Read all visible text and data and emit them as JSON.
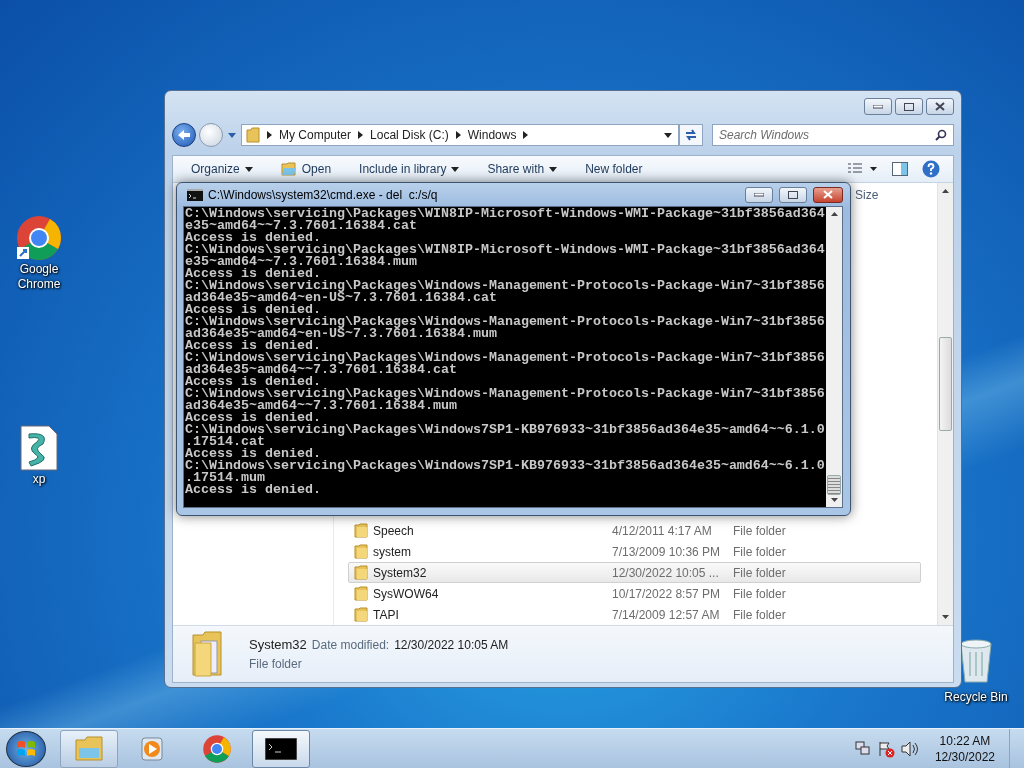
{
  "desktop_icons": [
    {
      "kind": "chrome",
      "label": "Google Chrome"
    },
    {
      "kind": "script",
      "label": "xp"
    },
    {
      "kind": "recycle",
      "label": "Recycle Bin"
    }
  ],
  "explorer": {
    "breadcrumb": [
      "My Computer",
      "Local Disk (C:)",
      "Windows"
    ],
    "search": {
      "placeholder": "Search Windows"
    },
    "toolbar": [
      {
        "kind": "menu",
        "label": "Organize"
      },
      {
        "kind": "open",
        "label": "Open"
      },
      {
        "kind": "menu",
        "label": "Include in library"
      },
      {
        "kind": "menu",
        "label": "Share with"
      },
      {
        "kind": "plain",
        "label": "New folder"
      }
    ],
    "columns": [
      "Size"
    ],
    "rows": [
      {
        "name": "Speech",
        "date": "4/12/2011 4:17 AM",
        "type": "File folder",
        "selected": false
      },
      {
        "name": "system",
        "date": "7/13/2009 10:36 PM",
        "type": "File folder",
        "selected": false
      },
      {
        "name": "System32",
        "date": "12/30/2022 10:05 ...",
        "type": "File folder",
        "selected": true
      },
      {
        "name": "SysWOW64",
        "date": "10/17/2022 8:57 PM",
        "type": "File folder",
        "selected": false
      },
      {
        "name": "TAPI",
        "date": "7/14/2009 12:57 AM",
        "type": "File folder",
        "selected": false
      }
    ],
    "details": {
      "name": "System32",
      "date_label": "Date modified:",
      "date": "12/30/2022 10:05 AM",
      "type": "File folder"
    }
  },
  "cmd": {
    "title": "C:\\Windows\\system32\\cmd.exe - del  c:/s/q",
    "lines": [
      "C:\\Windows\\servicing\\Packages\\WIN8IP-Microsoft-Windows-WMI-Package~31bf3856ad364",
      "e35~amd64~~7.3.7601.16384.cat",
      "Access is denied.",
      "C:\\Windows\\servicing\\Packages\\WIN8IP-Microsoft-Windows-WMI-Package~31bf3856ad364",
      "e35~amd64~~7.3.7601.16384.mum",
      "Access is denied.",
      "C:\\Windows\\servicing\\Packages\\Windows-Management-Protocols-Package-Win7~31bf3856",
      "ad364e35~amd64~en-US~7.3.7601.16384.cat",
      "Access is denied.",
      "C:\\Windows\\servicing\\Packages\\Windows-Management-Protocols-Package-Win7~31bf3856",
      "ad364e35~amd64~en-US~7.3.7601.16384.mum",
      "Access is denied.",
      "C:\\Windows\\servicing\\Packages\\Windows-Management-Protocols-Package-Win7~31bf3856",
      "ad364e35~amd64~~7.3.7601.16384.cat",
      "Access is denied.",
      "C:\\Windows\\servicing\\Packages\\Windows-Management-Protocols-Package-Win7~31bf3856",
      "ad364e35~amd64~~7.3.7601.16384.mum",
      "Access is denied.",
      "C:\\Windows\\servicing\\Packages\\Windows7SP1-KB976933~31bf3856ad364e35~amd64~~6.1.0",
      ".17514.cat",
      "Access is denied.",
      "C:\\Windows\\servicing\\Packages\\Windows7SP1-KB976933~31bf3856ad364e35~amd64~~6.1.0",
      ".17514.mum",
      "Access is denied."
    ]
  },
  "taskbar": {
    "items": [
      {
        "kind": "explorer",
        "selected": false
      },
      {
        "kind": "media",
        "selected": false
      },
      {
        "kind": "chrome",
        "selected": false
      },
      {
        "kind": "cmd",
        "selected": true
      }
    ],
    "time": "10:22 AM",
    "date": "12/30/2022"
  }
}
